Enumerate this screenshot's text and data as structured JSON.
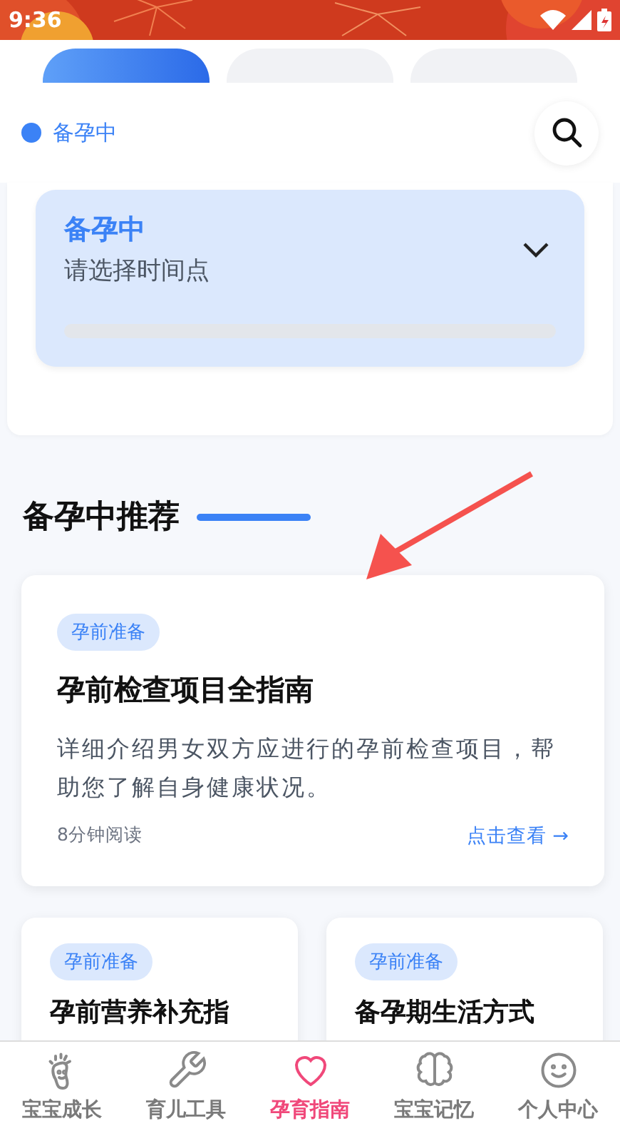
{
  "status_bar": {
    "time": "9:36"
  },
  "tabs": [
    {
      "selected": true
    },
    {
      "selected": false
    },
    {
      "selected": false
    }
  ],
  "sticky_header": {
    "label": "备孕中"
  },
  "stage_panel": {
    "title": "备孕中",
    "subtitle": "请选择时间点",
    "level": 0
  },
  "section": {
    "title": "备孕中推荐"
  },
  "featured_article": {
    "tag": "孕前准备",
    "title": "孕前检查项目全指南",
    "description": "详细介绍男女双方应进行的孕前检查项目，帮助您了解自身健康状况。",
    "read_time": "8分钟阅读",
    "link": "点击查看 →"
  },
  "articles": [
    {
      "tag": "孕前准备",
      "title": "孕前营养补充指"
    },
    {
      "tag": "孕前准备",
      "title": "备孕期生活方式"
    }
  ],
  "bottom_nav": [
    {
      "label": "宝宝成长",
      "kind": "foot",
      "selected": false
    },
    {
      "label": "育儿工具",
      "kind": "wrench",
      "selected": false
    },
    {
      "label": "孕育指南",
      "kind": "heart",
      "selected": true
    },
    {
      "label": "宝宝记忆",
      "kind": "brain",
      "selected": false
    },
    {
      "label": "个人中心",
      "kind": "smile",
      "selected": false
    }
  ]
}
